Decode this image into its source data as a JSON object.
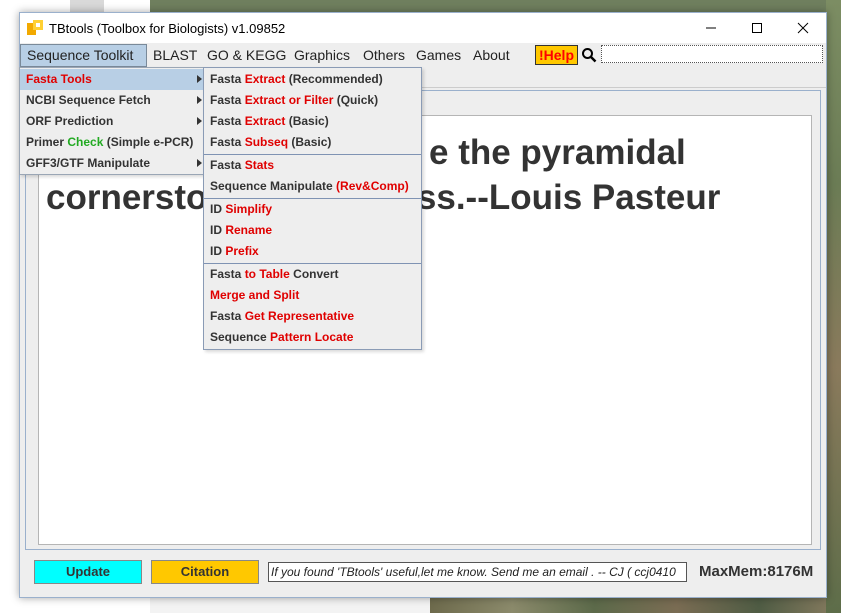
{
  "window": {
    "title": "TBtools (Toolbox for Biologists) v1.09852",
    "controls": {
      "minimize": "—",
      "maximize": "☐",
      "close": "✕"
    }
  },
  "menubar": {
    "items": [
      "Sequence Toolkit",
      "BLAST",
      "GO & KEGG",
      "Graphics",
      "Others",
      "Games",
      "About"
    ],
    "help": "!Help"
  },
  "main_menu": {
    "items": [
      {
        "segments": [
          {
            "text": "Fasta Tools",
            "color": "red"
          }
        ]
      },
      {
        "segments": [
          {
            "text": "NCBI Sequence Fetch",
            "color": "normal"
          }
        ]
      },
      {
        "segments": [
          {
            "text": "ORF Prediction",
            "color": "normal"
          }
        ]
      },
      {
        "segments": [
          {
            "text": "Primer ",
            "color": "normal"
          },
          {
            "text": "Check",
            "color": "green"
          },
          {
            "text": " (Simple e-PCR)",
            "color": "normal"
          }
        ]
      },
      {
        "segments": [
          {
            "text": "GFF3/GTF Manipulate",
            "color": "normal"
          }
        ]
      }
    ]
  },
  "sub_menu": {
    "items": [
      [
        {
          "text": "Fasta ",
          "color": "normal"
        },
        {
          "text": "Extract",
          "color": "red"
        },
        {
          "text": " (Recommended)",
          "color": "normal"
        }
      ],
      [
        {
          "text": "Fasta ",
          "color": "normal"
        },
        {
          "text": "Extract or Filter",
          "color": "red"
        },
        {
          "text": " (Quick)",
          "color": "normal"
        }
      ],
      [
        {
          "text": "Fasta ",
          "color": "normal"
        },
        {
          "text": "Extract",
          "color": "red"
        },
        {
          "text": " (Basic)",
          "color": "normal"
        }
      ],
      [
        {
          "text": "Fasta ",
          "color": "normal"
        },
        {
          "text": "Subseq",
          "color": "red"
        },
        {
          "text": " (Basic)",
          "color": "normal"
        }
      ],
      [
        {
          "text": "Fasta ",
          "color": "normal"
        },
        {
          "text": "Stats",
          "color": "red"
        }
      ],
      [
        {
          "text": "Sequence Manipulate ",
          "color": "normal"
        },
        {
          "text": "(Rev&Comp)",
          "color": "red"
        }
      ],
      [
        {
          "text": "ID ",
          "color": "normal"
        },
        {
          "text": "Simplify",
          "color": "red"
        }
      ],
      [
        {
          "text": "ID ",
          "color": "normal"
        },
        {
          "text": "Rename",
          "color": "red"
        }
      ],
      [
        {
          "text": "ID ",
          "color": "normal"
        },
        {
          "text": "Prefix",
          "color": "red"
        }
      ],
      [
        {
          "text": "Fasta ",
          "color": "normal"
        },
        {
          "text": "to Table",
          "color": "red"
        },
        {
          "text": " Convert",
          "color": "normal"
        }
      ],
      [
        {
          "text": "Merge and Split",
          "color": "red"
        }
      ],
      [
        {
          "text": "Fasta ",
          "color": "normal"
        },
        {
          "text": "Get Representative",
          "color": "red"
        }
      ],
      [
        {
          "text": "Sequence ",
          "color": "normal"
        },
        {
          "text": "Pattern Locate",
          "color": "red"
        }
      ]
    ]
  },
  "quote": {
    "line1_visible": "e the pyramidal",
    "line2_start": "cornersto",
    "line2_end": "ess.--Louis Pasteur"
  },
  "bottom": {
    "update_label": "Update",
    "citation_label": "Citation",
    "message": "If you found 'TBtools' useful,let me know. Send me an email . -- CJ   ( ccj0410",
    "maxmem": "MaxMem:8176M"
  },
  "colors": {
    "accent_menu": "#b8cfe5",
    "update_button": "#00ffff",
    "citation_button": "#ffc800",
    "help_bg": "#ffc800",
    "red_text": "#e00000",
    "green_text": "#22aa22"
  }
}
